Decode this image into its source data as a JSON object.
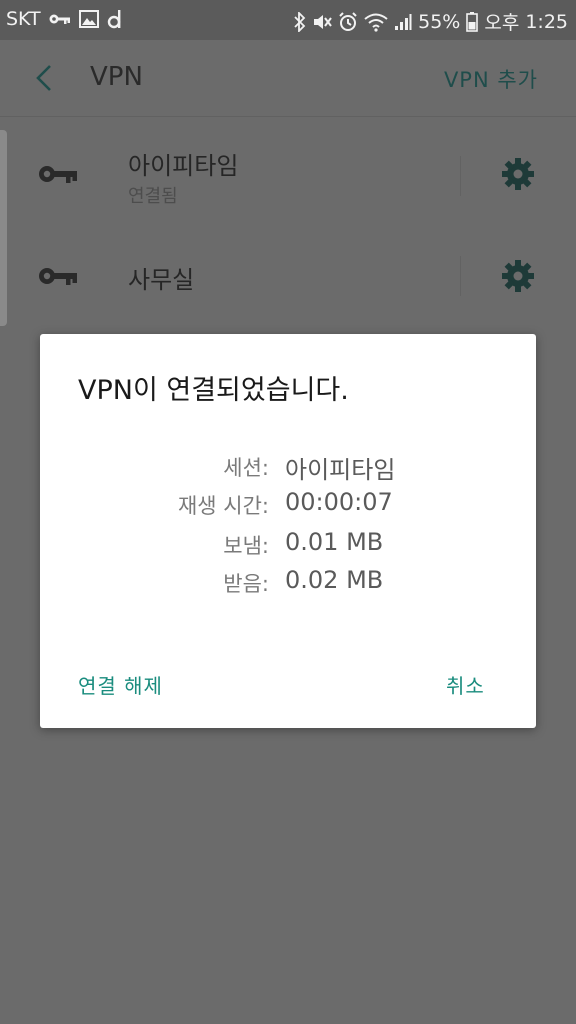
{
  "status_bar": {
    "carrier": "SKT",
    "battery": "55%",
    "ampm": "오후",
    "time": "1:25",
    "left_icons": [
      "key-icon",
      "image-icon",
      "d-app-icon"
    ],
    "right_icons": [
      "bluetooth-icon",
      "mute-icon",
      "alarm-icon",
      "wifi-icon",
      "signal-icon",
      "battery-icon"
    ]
  },
  "app_bar": {
    "title": "VPN",
    "action_label": "VPN 추가"
  },
  "vpn_list": [
    {
      "name": "아이피타임",
      "status": "연결됨"
    },
    {
      "name": "사무실",
      "status": ""
    }
  ],
  "dialog": {
    "title": "VPN이 연결되었습니다.",
    "rows": [
      {
        "label": "세션:",
        "value": "아이피타임"
      },
      {
        "label": "재생 시간:",
        "value": "00:00:07"
      },
      {
        "label": "보냄:",
        "value": "0.01 MB"
      },
      {
        "label": "받음:",
        "value": "0.02 MB"
      }
    ],
    "disconnect_label": "연결 해제",
    "cancel_label": "취소"
  },
  "colors": {
    "accent": "#1a8c7e",
    "icon_dark": "#1e3a38",
    "scrim_bg": "#6b6b6b"
  }
}
